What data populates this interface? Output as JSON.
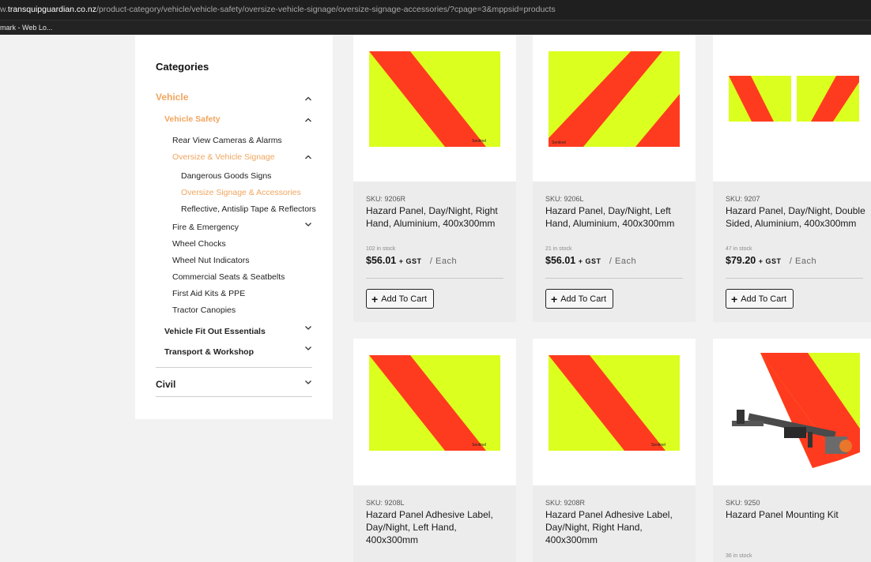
{
  "browser": {
    "url_prefix": "w.",
    "url_host": "transquipguardian.co.nz",
    "url_path": "/product-category/vehicle/vehicle-safety/oversize-vehicle-signage/oversize-signage-accessories/?cpage=3&mppsid=products",
    "bookmark_label": "mark - Web Lo..."
  },
  "sidebar": {
    "title": "Categories",
    "items": [
      {
        "label": "Vehicle",
        "level": 0,
        "active": true,
        "bold": true,
        "chevron": "up"
      },
      {
        "label": "Vehicle Safety",
        "level": 1,
        "active": true,
        "bold": true,
        "chevron": "up"
      },
      {
        "label": "Rear View Cameras & Alarms",
        "level": 2,
        "active": false,
        "bold": false,
        "chevron": "none"
      },
      {
        "label": "Oversize & Vehicle Signage",
        "level": 2,
        "active": true,
        "bold": false,
        "chevron": "up"
      },
      {
        "label": "Dangerous Goods Signs",
        "level": 3,
        "active": false,
        "bold": false,
        "chevron": "none"
      },
      {
        "label": "Oversize Signage & Accessories",
        "level": 3,
        "active": true,
        "bold": false,
        "chevron": "none"
      },
      {
        "label": "Reflective, Antislip Tape & Reflectors",
        "level": 3,
        "active": false,
        "bold": false,
        "chevron": "none"
      },
      {
        "label": "Fire & Emergency",
        "level": 2,
        "active": false,
        "bold": false,
        "chevron": "down"
      },
      {
        "label": "Wheel Chocks",
        "level": 2,
        "active": false,
        "bold": false,
        "chevron": "none"
      },
      {
        "label": "Wheel Nut Indicators",
        "level": 2,
        "active": false,
        "bold": false,
        "chevron": "none"
      },
      {
        "label": "Commercial Seats & Seatbelts",
        "level": 2,
        "active": false,
        "bold": false,
        "chevron": "none"
      },
      {
        "label": "First Aid Kits & PPE",
        "level": 2,
        "active": false,
        "bold": false,
        "chevron": "none"
      },
      {
        "label": "Tractor Canopies",
        "level": 2,
        "active": false,
        "bold": false,
        "chevron": "none"
      },
      {
        "label": "Vehicle Fit Out Essentials",
        "level": 1,
        "active": false,
        "bold": true,
        "chevron": "down"
      },
      {
        "label": "Transport & Workshop",
        "level": 1,
        "active": false,
        "bold": true,
        "chevron": "down"
      },
      {
        "label": "Civil",
        "level": 0,
        "active": false,
        "bold": true,
        "chevron": "down"
      }
    ]
  },
  "products": [
    {
      "sku": "SKU: 9206R",
      "name": "Hazard Panel, Day/Night, Right Hand, Aluminium, 400x300mm",
      "stock": "102 in stock",
      "price": "$56.01",
      "gst": "+ GST",
      "unit": "/ Each",
      "button": "Add To Cart",
      "image": "hazard-panel-single"
    },
    {
      "sku": "SKU: 9206L",
      "name": "Hazard Panel, Day/Night, Left Hand, Aluminium, 400x300mm",
      "stock": "21 in stock",
      "price": "$56.01",
      "gst": "+ GST",
      "unit": "/ Each",
      "button": "Add To Cart",
      "image": "hazard-panel-single"
    },
    {
      "sku": "SKU: 9207",
      "name": "Hazard Panel, Day/Night, Double Sided, Aluminium, 400x300mm",
      "stock": "47 in stock",
      "price": "$79.20",
      "gst": "+ GST",
      "unit": "/ Each",
      "button": "Add To Cart",
      "image": "hazard-panel-double"
    },
    {
      "sku": "SKU: 9208L",
      "name": "Hazard Panel Adhesive Label, Day/Night, Left Hand, 400x300mm",
      "stock": "",
      "price": "",
      "gst": "",
      "unit": "",
      "button": "",
      "image": "hazard-panel-single"
    },
    {
      "sku": "SKU: 9208R",
      "name": "Hazard Panel Adhesive Label, Day/Night, Right Hand, 400x300mm",
      "stock": "",
      "price": "",
      "gst": "",
      "unit": "",
      "button": "",
      "image": "hazard-panel-single"
    },
    {
      "sku": "SKU: 9250",
      "name": "Hazard Panel Mounting Kit",
      "stock": "36 in stock",
      "price": "",
      "gst": "",
      "unit": "",
      "button": "",
      "image": "mounting-kit"
    }
  ],
  "brand_mark": "Sentinel",
  "colors": {
    "accent": "#f0a55e",
    "panel_yellow": "#dbff1e",
    "panel_red": "#ff3b1f"
  }
}
